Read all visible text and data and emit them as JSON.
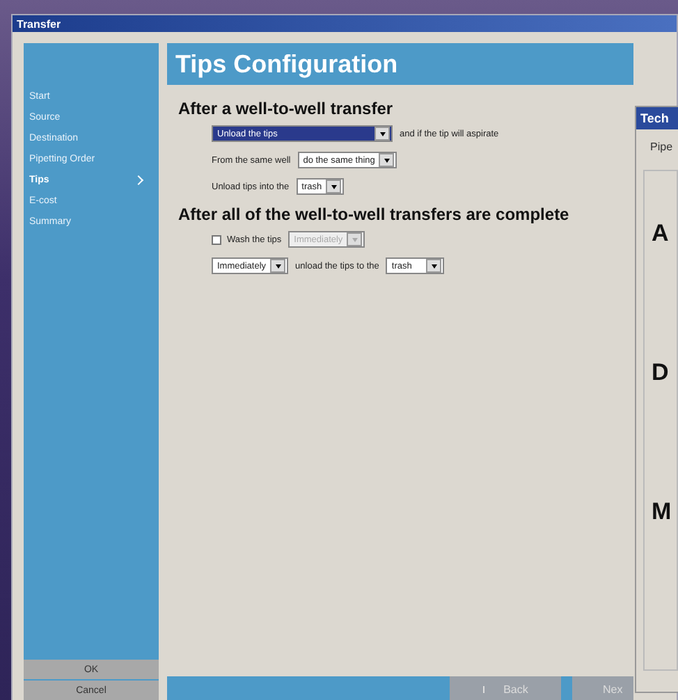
{
  "window": {
    "title": "Transfer"
  },
  "sidebar": {
    "items": [
      {
        "label": "Start",
        "selected": false
      },
      {
        "label": "Source",
        "selected": false
      },
      {
        "label": "Destination",
        "selected": false
      },
      {
        "label": "Pipetting Order",
        "selected": false
      },
      {
        "label": "Tips",
        "selected": true
      },
      {
        "label": "E-cost",
        "selected": false
      },
      {
        "label": "Summary",
        "selected": false
      }
    ]
  },
  "dialog_buttons": [
    "OK",
    "Cancel"
  ],
  "header": "Tips Configuration",
  "sections": [
    {
      "heading": "After a well-to-well transfer",
      "rows": [
        [
          {
            "kind": "dropdown",
            "value": "Unload the tips",
            "highlighted": true,
            "disabled": false
          },
          {
            "kind": "label",
            "text": "and if the tip will aspirate"
          }
        ],
        [
          {
            "kind": "label",
            "text": "From the same well"
          },
          {
            "kind": "dropdown",
            "value": "do the same thing",
            "highlighted": false,
            "disabled": false
          }
        ],
        [
          {
            "kind": "label",
            "text": "Unload tips into the"
          },
          {
            "kind": "dropdown",
            "value": "trash",
            "highlighted": false,
            "disabled": false
          }
        ]
      ]
    },
    {
      "heading": "After all of the well-to-well transfers are complete",
      "rows": [
        [
          {
            "kind": "checkbox",
            "text": "Wash the tips",
            "checked": false
          },
          {
            "kind": "dropdown",
            "value": "Immediately",
            "highlighted": false,
            "disabled": true
          }
        ],
        [
          {
            "kind": "dropdown",
            "value": "Immediately",
            "highlighted": false,
            "disabled": false
          },
          {
            "kind": "label",
            "text": "unload the tips to the"
          },
          {
            "kind": "dropdown",
            "value": "trash",
            "highlighted": false,
            "disabled": false
          }
        ]
      ]
    }
  ],
  "nav": {
    "back": "Back",
    "next": "Nex"
  },
  "overlay_window": {
    "title": "Tech",
    "label": "Pipe",
    "letters": [
      "A",
      "D",
      "M"
    ]
  }
}
